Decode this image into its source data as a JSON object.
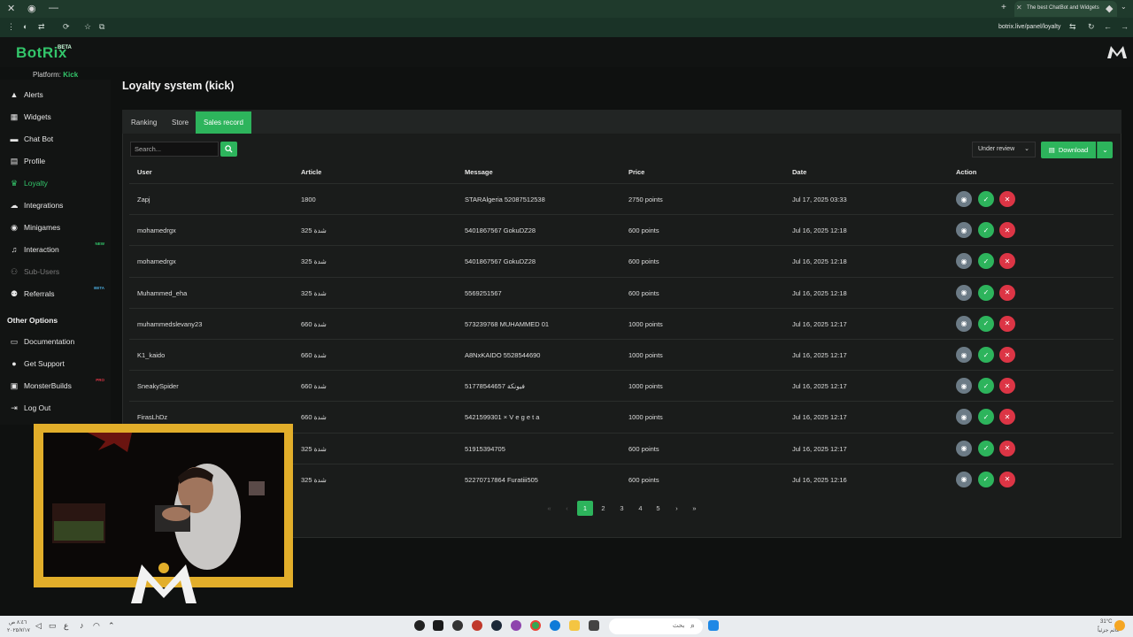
{
  "browser": {
    "tab_title": "The best ChatBot and Widgets",
    "url": "botrix.live/panel/loyalty"
  },
  "app": {
    "logo": "BotRix",
    "logo_badge": "BETA",
    "platform_label": "Platform:",
    "platform_value": "Kick"
  },
  "sidebar": {
    "items": [
      {
        "label": "Alerts",
        "icon": "warning-icon"
      },
      {
        "label": "Widgets",
        "icon": "grid-icon"
      },
      {
        "label": "Chat Bot",
        "icon": "chat-icon"
      },
      {
        "label": "Profile",
        "icon": "profile-icon"
      },
      {
        "label": "Loyalty",
        "icon": "trophy-icon"
      },
      {
        "label": "Integrations",
        "icon": "cloud-icon"
      },
      {
        "label": "Minigames",
        "icon": "gamepad-icon"
      },
      {
        "label": "Interaction",
        "icon": "music-icon",
        "badge": "NEW"
      },
      {
        "label": "Sub-Users",
        "icon": "users-icon"
      },
      {
        "label": "Referrals",
        "icon": "people-icon",
        "badge": "BETA"
      }
    ],
    "other_title": "Other Options",
    "other_items": [
      {
        "label": "Documentation",
        "icon": "docs-icon"
      },
      {
        "label": "Get Support",
        "icon": "help-icon"
      },
      {
        "label": "MonsterBuilds",
        "icon": "monitor-icon",
        "badge": "PRO"
      },
      {
        "label": "Log Out",
        "icon": "logout-icon"
      }
    ]
  },
  "page": {
    "title": "Loyalty system (kick)",
    "tabs": [
      "Ranking",
      "Store",
      "Sales record"
    ],
    "active_tab": "Sales record",
    "search_placeholder": "Search...",
    "status_filter": "Under review",
    "download_label": "Download"
  },
  "table": {
    "columns": [
      "User",
      "Article",
      "Message",
      "Price",
      "Date",
      "Action"
    ],
    "rows": [
      {
        "user": "Zapj",
        "article": "1800",
        "message": "STARAlgeria 52087512538",
        "price": "2750 points",
        "date": "Jul 17, 2025 03:33"
      },
      {
        "user": "mohamedrgx",
        "article": "325 شدة",
        "message": "5401867567 GokuDZ28",
        "price": "600 points",
        "date": "Jul 16, 2025 12:18"
      },
      {
        "user": "mohamedrgx",
        "article": "325 شدة",
        "message": "5401867567 GokuDZ28",
        "price": "600 points",
        "date": "Jul 16, 2025 12:18"
      },
      {
        "user": "Muhammed_eha",
        "article": "325 شدة",
        "message": "5569251567",
        "price": "600 points",
        "date": "Jul 16, 2025 12:18"
      },
      {
        "user": "muhammedslevany23",
        "article": "660 شدة",
        "message": "573239768 MUHAMMED 01",
        "price": "1000 points",
        "date": "Jul 16, 2025 12:17"
      },
      {
        "user": "K1_kaido",
        "article": "660 شدة",
        "message": "A8NxKAIDO 5528544690",
        "price": "1000 points",
        "date": "Jul 16, 2025 12:17"
      },
      {
        "user": "SneakySpider",
        "article": "660 شدة",
        "message": "51778544657 فيونكة",
        "price": "1000 points",
        "date": "Jul 16, 2025 12:17"
      },
      {
        "user": "FirasLhDz",
        "article": "660 شدة",
        "message": "5421599301 × V e g e t a",
        "price": "1000 points",
        "date": "Jul 16, 2025 12:17"
      },
      {
        "user": "",
        "article": "325 شدة",
        "message": "51915394705",
        "price": "600 points",
        "date": "Jul 16, 2025 12:17"
      },
      {
        "user": "",
        "article": "325 شدة",
        "message": "52270717864 Furatiii505",
        "price": "600 points",
        "date": "Jul 16, 2025 12:16"
      }
    ]
  },
  "pagination": {
    "pages": [
      "1",
      "2",
      "3",
      "4",
      "5"
    ],
    "current": "1"
  },
  "taskbar": {
    "left_time": "٨:٤٦ ص",
    "left_date": "٢٠٢٥/٧/١٧",
    "search_text": "بحث",
    "weather": "31°C",
    "weather_desc": "غائم جزئياً"
  },
  "colors": {
    "accent": "#2db45c",
    "danger": "#dc3545",
    "view": "#6c7b86",
    "bg": "#0f1110"
  }
}
